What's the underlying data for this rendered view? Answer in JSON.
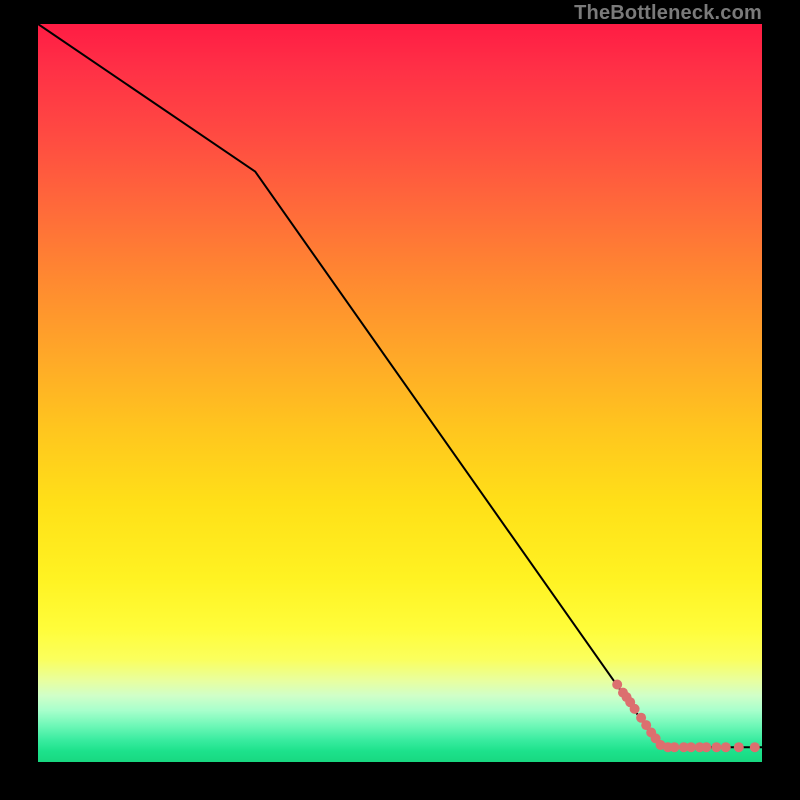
{
  "watermark": {
    "text": "TheBottleneck.com"
  },
  "chart_data": {
    "type": "line",
    "title": "",
    "xlabel": "",
    "ylabel": "",
    "xlim": [
      0,
      100
    ],
    "ylim": [
      0,
      100
    ],
    "series": [
      {
        "name": "bottleneck-curve",
        "x": [
          0,
          30,
          86,
          100
        ],
        "y": [
          100,
          80,
          2,
          2
        ],
        "color": "#000000",
        "stroke_width": 2
      }
    ],
    "points": {
      "name": "highlighted-range",
      "color": "#dc6f6f",
      "radius": 5,
      "data": [
        {
          "x": 80.0,
          "y": 10.5
        },
        {
          "x": 80.8,
          "y": 9.4
        },
        {
          "x": 81.3,
          "y": 8.8
        },
        {
          "x": 81.8,
          "y": 8.1
        },
        {
          "x": 82.4,
          "y": 7.2
        },
        {
          "x": 83.3,
          "y": 6.0
        },
        {
          "x": 84.0,
          "y": 5.0
        },
        {
          "x": 84.7,
          "y": 4.0
        },
        {
          "x": 85.3,
          "y": 3.2
        },
        {
          "x": 86.0,
          "y": 2.3
        },
        {
          "x": 87.0,
          "y": 2.0
        },
        {
          "x": 87.9,
          "y": 2.0
        },
        {
          "x": 89.2,
          "y": 2.0
        },
        {
          "x": 90.2,
          "y": 2.0
        },
        {
          "x": 91.4,
          "y": 2.0
        },
        {
          "x": 92.3,
          "y": 2.0
        },
        {
          "x": 93.7,
          "y": 2.0
        },
        {
          "x": 95.0,
          "y": 2.0
        },
        {
          "x": 96.8,
          "y": 2.0
        },
        {
          "x": 99.0,
          "y": 2.0
        }
      ]
    },
    "background": {
      "type": "vertical-gradient",
      "stops": [
        {
          "pos": 0,
          "color": "#ff1c44"
        },
        {
          "pos": 50,
          "color": "#ffc61e"
        },
        {
          "pos": 85,
          "color": "#fff94a"
        },
        {
          "pos": 100,
          "color": "#18d880"
        }
      ]
    }
  }
}
